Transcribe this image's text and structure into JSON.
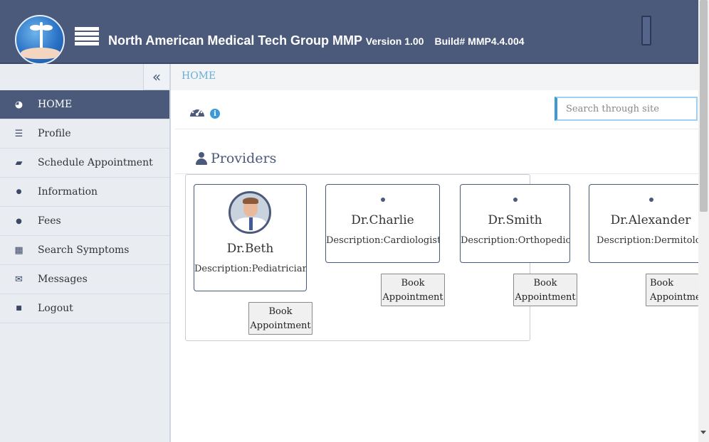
{
  "header": {
    "title": "North American Medical Tech Group MMP",
    "version": "Version 1.00",
    "build": "Build# MMP4.4.004",
    "logo_icon": "caduceus-hand-logo",
    "menu_icon": "list-icon"
  },
  "sidebar": {
    "collapse_glyph": "«",
    "items": [
      {
        "label": "HOME",
        "icon": "dashboard-icon",
        "glyph": "◕",
        "active": true
      },
      {
        "label": "Profile",
        "icon": "indent-list-icon",
        "glyph": "☰",
        "active": false
      },
      {
        "label": "Schedule Appointment",
        "icon": "book-icon",
        "glyph": "▰",
        "active": false
      },
      {
        "label": "Information",
        "icon": "drop-icon",
        "glyph": "●",
        "active": false
      },
      {
        "label": "Fees",
        "icon": "user-icon",
        "glyph": "●",
        "active": false
      },
      {
        "label": "Search Symptoms",
        "icon": "table-icon",
        "glyph": "▦",
        "active": false
      },
      {
        "label": "Messages",
        "icon": "envelope-icon",
        "glyph": "✉",
        "active": false
      },
      {
        "label": "Logout",
        "icon": "lock-icon",
        "glyph": "■",
        "active": false
      }
    ]
  },
  "breadcrumb": "HOME",
  "search": {
    "placeholder": "Search through site",
    "value": ""
  },
  "info_glyph": "i",
  "providers": {
    "title": "Providers",
    "cards": [
      {
        "name": "Dr.Beth",
        "description": "Description:Pediatrician",
        "has_photo": true,
        "button": "Book Appointment"
      },
      {
        "name": "Dr.Charlie",
        "description": "Description:Cardiologist",
        "has_photo": false,
        "button": "Book Appointment"
      },
      {
        "name": "Dr.Smith",
        "description": "Description:Orthopedic",
        "has_photo": false,
        "button": "Book Appointment"
      },
      {
        "name": "Dr.Alexander",
        "description": "Description:Dermitologist",
        "has_photo": false,
        "button": "Book Appointment"
      }
    ]
  },
  "colors": {
    "header_bg": "#4b5a7a",
    "sidebar_bg": "#e9edf2",
    "active_nav": "#4b5a7a",
    "link": "#6aaed6",
    "accent": "#3d9ad6"
  }
}
